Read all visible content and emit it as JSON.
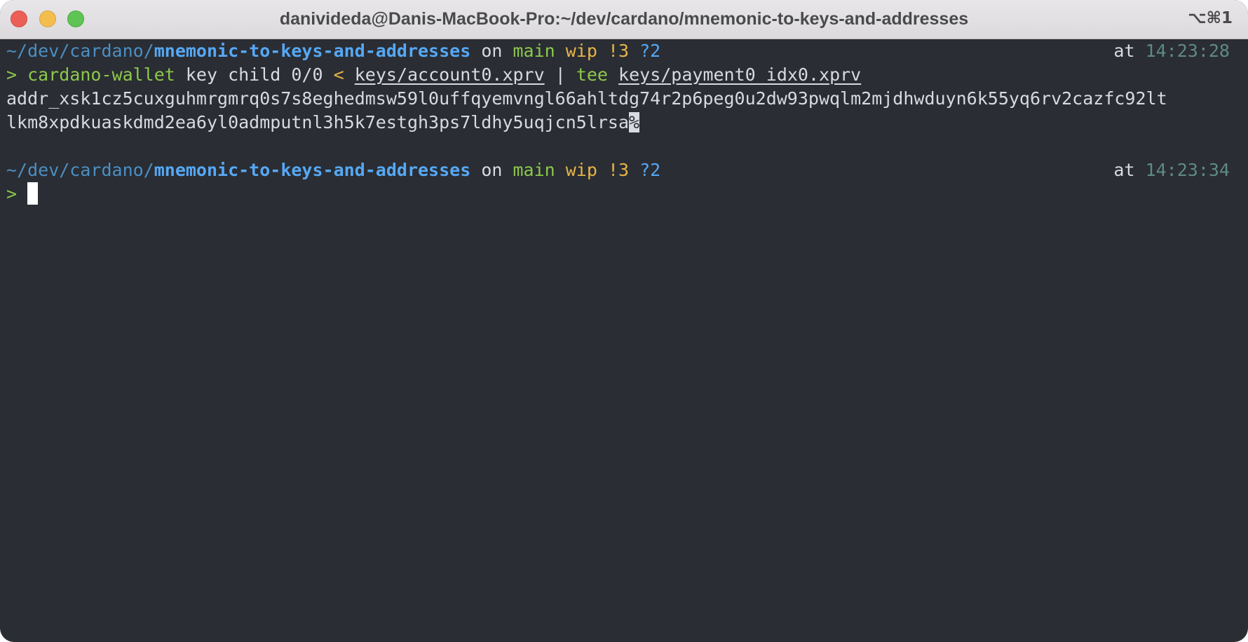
{
  "window": {
    "title": "danivideda@Danis-MacBook-Pro:~/dev/cardano/mnemonic-to-keys-and-addresses",
    "shortcut": "⌥⌘1"
  },
  "colors": {
    "background": "#2a2d33",
    "path": "#4a8fc4",
    "repo": "#56a8f5",
    "branch": "#8cc84b",
    "wip": "#e5b547",
    "time": "#5e8a86"
  },
  "prompt1": {
    "path_prefix": "~/dev/cardano/",
    "repo": "mnemonic-to-keys-and-addresses",
    "on": " on ",
    "branch": "main",
    "wip": " wip",
    "modified": " !3",
    "untracked": " ?2",
    "at": "at ",
    "time": "14:23:28"
  },
  "command1": {
    "prompt_symbol": "> ",
    "program": "cardano-wallet",
    "args": " key child 0/0 ",
    "redirect": "<",
    "input_file": "keys/account0.xprv",
    "pipe": " | ",
    "tee": "tee",
    "output_file": "keys/payment0_idx0.xprv"
  },
  "output": {
    "line1": "addr_xsk1cz5cuxguhmrgmrq0s7s8eghedmsw59l0uffqyemvngl66ahltdg74r2p6peg0u2dw93pwqlm2mjdhwduyn6k55yq6rv2cazfc92lt",
    "line2": "lkm8xpdkuaskdmd2ea6yl0admputnl3h5k7estgh3ps7ldhy5uqjcn5lrsa",
    "no_newline_marker": "%"
  },
  "prompt2": {
    "path_prefix": "~/dev/cardano/",
    "repo": "mnemonic-to-keys-and-addresses",
    "on": " on ",
    "branch": "main",
    "wip": " wip",
    "modified": " !3",
    "untracked": " ?2",
    "at": "at ",
    "time": "14:23:34"
  },
  "command2": {
    "prompt_symbol": "> "
  }
}
